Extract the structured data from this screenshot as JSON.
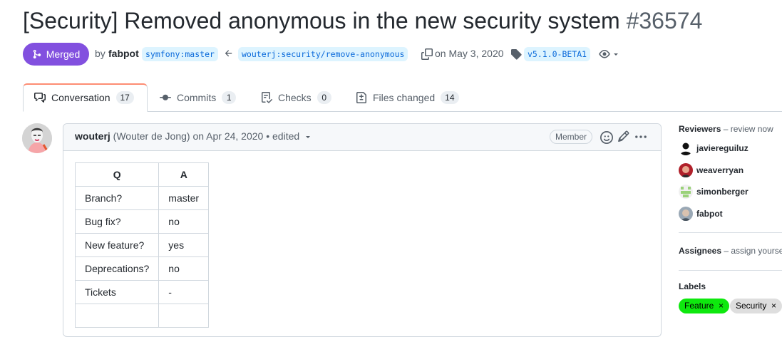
{
  "pr": {
    "title": "[Security] Removed anonymous in the new security system",
    "number": "#36574",
    "status": "Merged",
    "by_prefix": "by",
    "author": "fabpot",
    "base_branch": "symfony:master",
    "head_branch": "wouterj:security/remove-anonymous",
    "merged_on": "on May 3, 2020",
    "tag": "v5.1.0-BETA1"
  },
  "tabs": [
    {
      "label": "Conversation",
      "count": "17",
      "icon": "comment-icon"
    },
    {
      "label": "Commits",
      "count": "1",
      "icon": "commit-icon"
    },
    {
      "label": "Checks",
      "count": "0",
      "icon": "checklist-icon"
    },
    {
      "label": "Files changed",
      "count": "14",
      "icon": "file-diff-icon"
    }
  ],
  "comment": {
    "author": "wouterj",
    "full_name": "(Wouter de Jong)",
    "date": "on Apr 24, 2020",
    "edited": "• edited",
    "role": "Member",
    "table": {
      "headers": [
        "Q",
        "A"
      ],
      "rows": [
        [
          "Branch?",
          "master"
        ],
        [
          "Bug fix?",
          "no"
        ],
        [
          "New feature?",
          "yes"
        ],
        [
          "Deprecations?",
          "no"
        ],
        [
          "Tickets",
          "-"
        ]
      ]
    }
  },
  "sidebar": {
    "reviewers_title": "Reviewers",
    "reviewers_note": "– review now",
    "reviewers": [
      "javiereguiluz",
      "weaverryan",
      "simonberger",
      "fabpot"
    ],
    "assignees_title": "Assignees",
    "assignees_note": "– assign yourse",
    "labels_title": "Labels",
    "labels": [
      {
        "name": "Feature",
        "color": "#0ee80e"
      },
      {
        "name": "Security",
        "color": "#dedede"
      }
    ]
  },
  "colors": {
    "merged": "#8250df",
    "accent_blue": "#0969da",
    "tab_active_border": "#fd8c73"
  }
}
